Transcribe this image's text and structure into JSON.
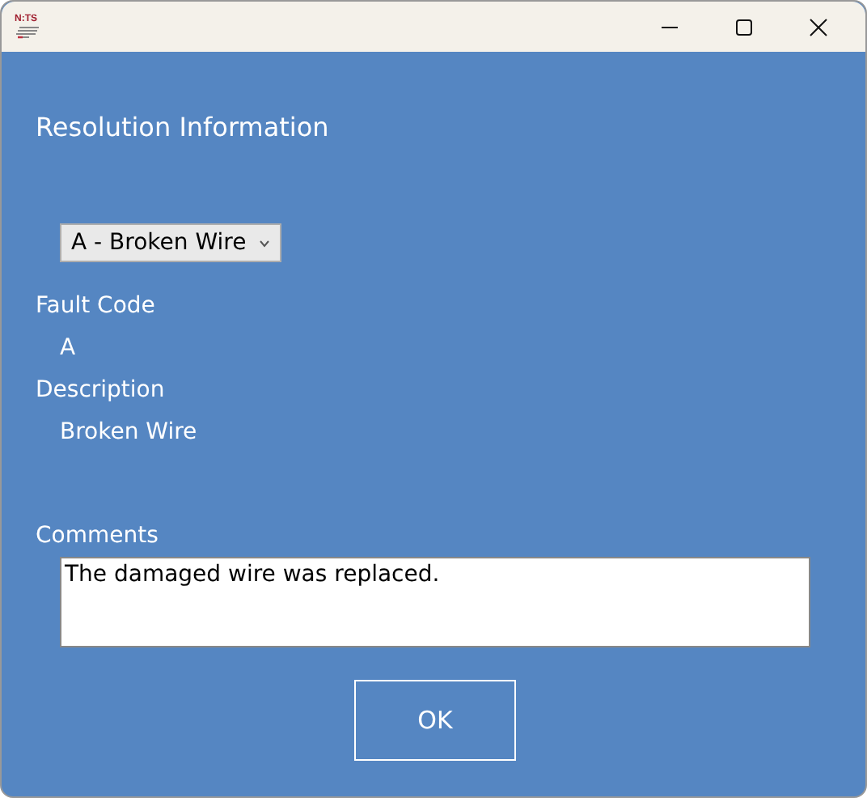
{
  "window": {
    "logo": "N:TS"
  },
  "heading": "Resolution Information",
  "fault_dropdown": {
    "value": "A - Broken Wire"
  },
  "fields": [
    {
      "label": "Fault Code",
      "value": "A"
    },
    {
      "label": "Description",
      "value": "Broken Wire"
    }
  ],
  "comments": {
    "label": "Comments",
    "value": "The damaged wire was replaced."
  },
  "buttons": [
    "OK"
  ]
}
